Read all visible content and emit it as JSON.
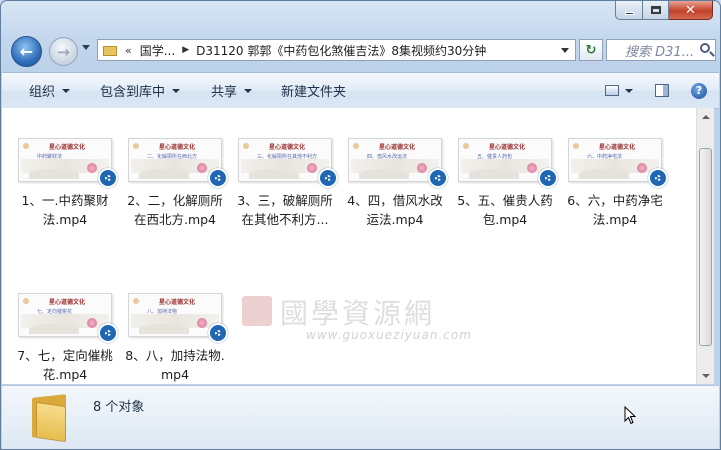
{
  "window": {
    "caption_buttons": {
      "minimize": "—",
      "maximize": "□",
      "close": "✕"
    }
  },
  "nav": {
    "back_icon": "back-arrow-icon",
    "forward_icon": "forward-arrow-icon",
    "address": {
      "overflow": "«",
      "crumbs": [
        "国学...",
        "D31120 郭郭《中药包化煞催吉法》8集视频约30分钟"
      ]
    },
    "search_placeholder": "搜索 D31..."
  },
  "toolbar": {
    "organize": "组织",
    "include_in_library": "包含到库中",
    "share": "共享",
    "new_folder": "新建文件夹",
    "help": "?"
  },
  "files": [
    {
      "name": "1、一.中药聚财法.mp4",
      "thumb_title": "星心道德文化",
      "thumb_sub": "中药聚财法"
    },
    {
      "name": "2、二，化解厕所在西北方.mp4",
      "thumb_title": "星心道德文化",
      "thumb_sub": "二、化解厕所在西北方"
    },
    {
      "name": "3、三，破解厕所在其他不利方...",
      "thumb_title": "星心道德文化",
      "thumb_sub": "三、化解厕所在其他不利方"
    },
    {
      "name": "4、四，借风水改运法.mp4",
      "thumb_title": "星心道德文化",
      "thumb_sub": "四、借风水改运法"
    },
    {
      "name": "5、五、催贵人药包.mp4",
      "thumb_title": "星心道德文化",
      "thumb_sub": "五、催贵人药包"
    },
    {
      "name": "6、六，中药净宅法.mp4",
      "thumb_title": "星心道德文化",
      "thumb_sub": "六、中药净宅法"
    },
    {
      "name": "7、七，定向催桃花.mp4",
      "thumb_title": "星心道德文化",
      "thumb_sub": "七、定向催桃花"
    },
    {
      "name": "8、八，加持法物.mp4",
      "thumb_title": "星心道德文化",
      "thumb_sub": "八、加持法物"
    }
  ],
  "watermark": {
    "cn": "國學資源網",
    "url": "www.guoxueziyuan.com"
  },
  "details": {
    "count": "8 个对象"
  }
}
